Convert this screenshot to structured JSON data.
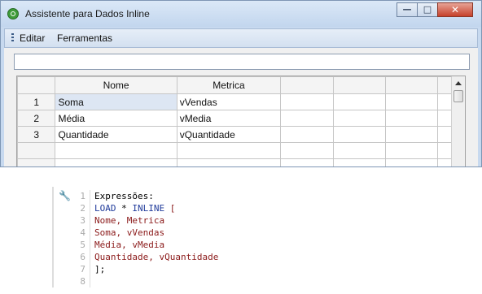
{
  "window": {
    "title": "Assistente para Dados Inline",
    "controls": {
      "minimize": "—",
      "maximize": "□",
      "close": "✕"
    }
  },
  "menu": {
    "items": [
      "Editar",
      "Ferramentas"
    ]
  },
  "input": {
    "value": ""
  },
  "grid": {
    "columns": [
      "Nome",
      "Metrica"
    ],
    "rows": [
      {
        "num": "1",
        "nome": "Soma",
        "metrica": "vVendas"
      },
      {
        "num": "2",
        "nome": "Média",
        "metrica": "vMedia"
      },
      {
        "num": "3",
        "nome": "Quantidade",
        "metrica": "vQuantidade"
      }
    ]
  },
  "code": {
    "line_numbers": [
      "1",
      "2",
      "3",
      "4",
      "5",
      "6",
      "7",
      "8"
    ],
    "lines": [
      [
        {
          "t": "Expressões:",
          "c": "plain"
        }
      ],
      [
        {
          "t": "LOAD",
          "c": "kw"
        },
        {
          "t": " * ",
          "c": "plain"
        },
        {
          "t": "INLINE",
          "c": "kw"
        },
        {
          "t": " [",
          "c": "str"
        }
      ],
      [
        {
          "t": "Nome, Metrica",
          "c": "str"
        }
      ],
      [
        {
          "t": "Soma, vVendas",
          "c": "str"
        }
      ],
      [
        {
          "t": "Média, vMedia",
          "c": "str"
        }
      ],
      [
        {
          "t": "Quantidade, vQuantidade",
          "c": "str"
        }
      ],
      [
        {
          "t": "];",
          "c": "plain"
        }
      ],
      []
    ]
  },
  "colors": {
    "keyword": "#1f3a9a",
    "string": "#8b1a1a",
    "selected_cell": "#dde6f3",
    "window_frame": "#c7d9ef"
  }
}
